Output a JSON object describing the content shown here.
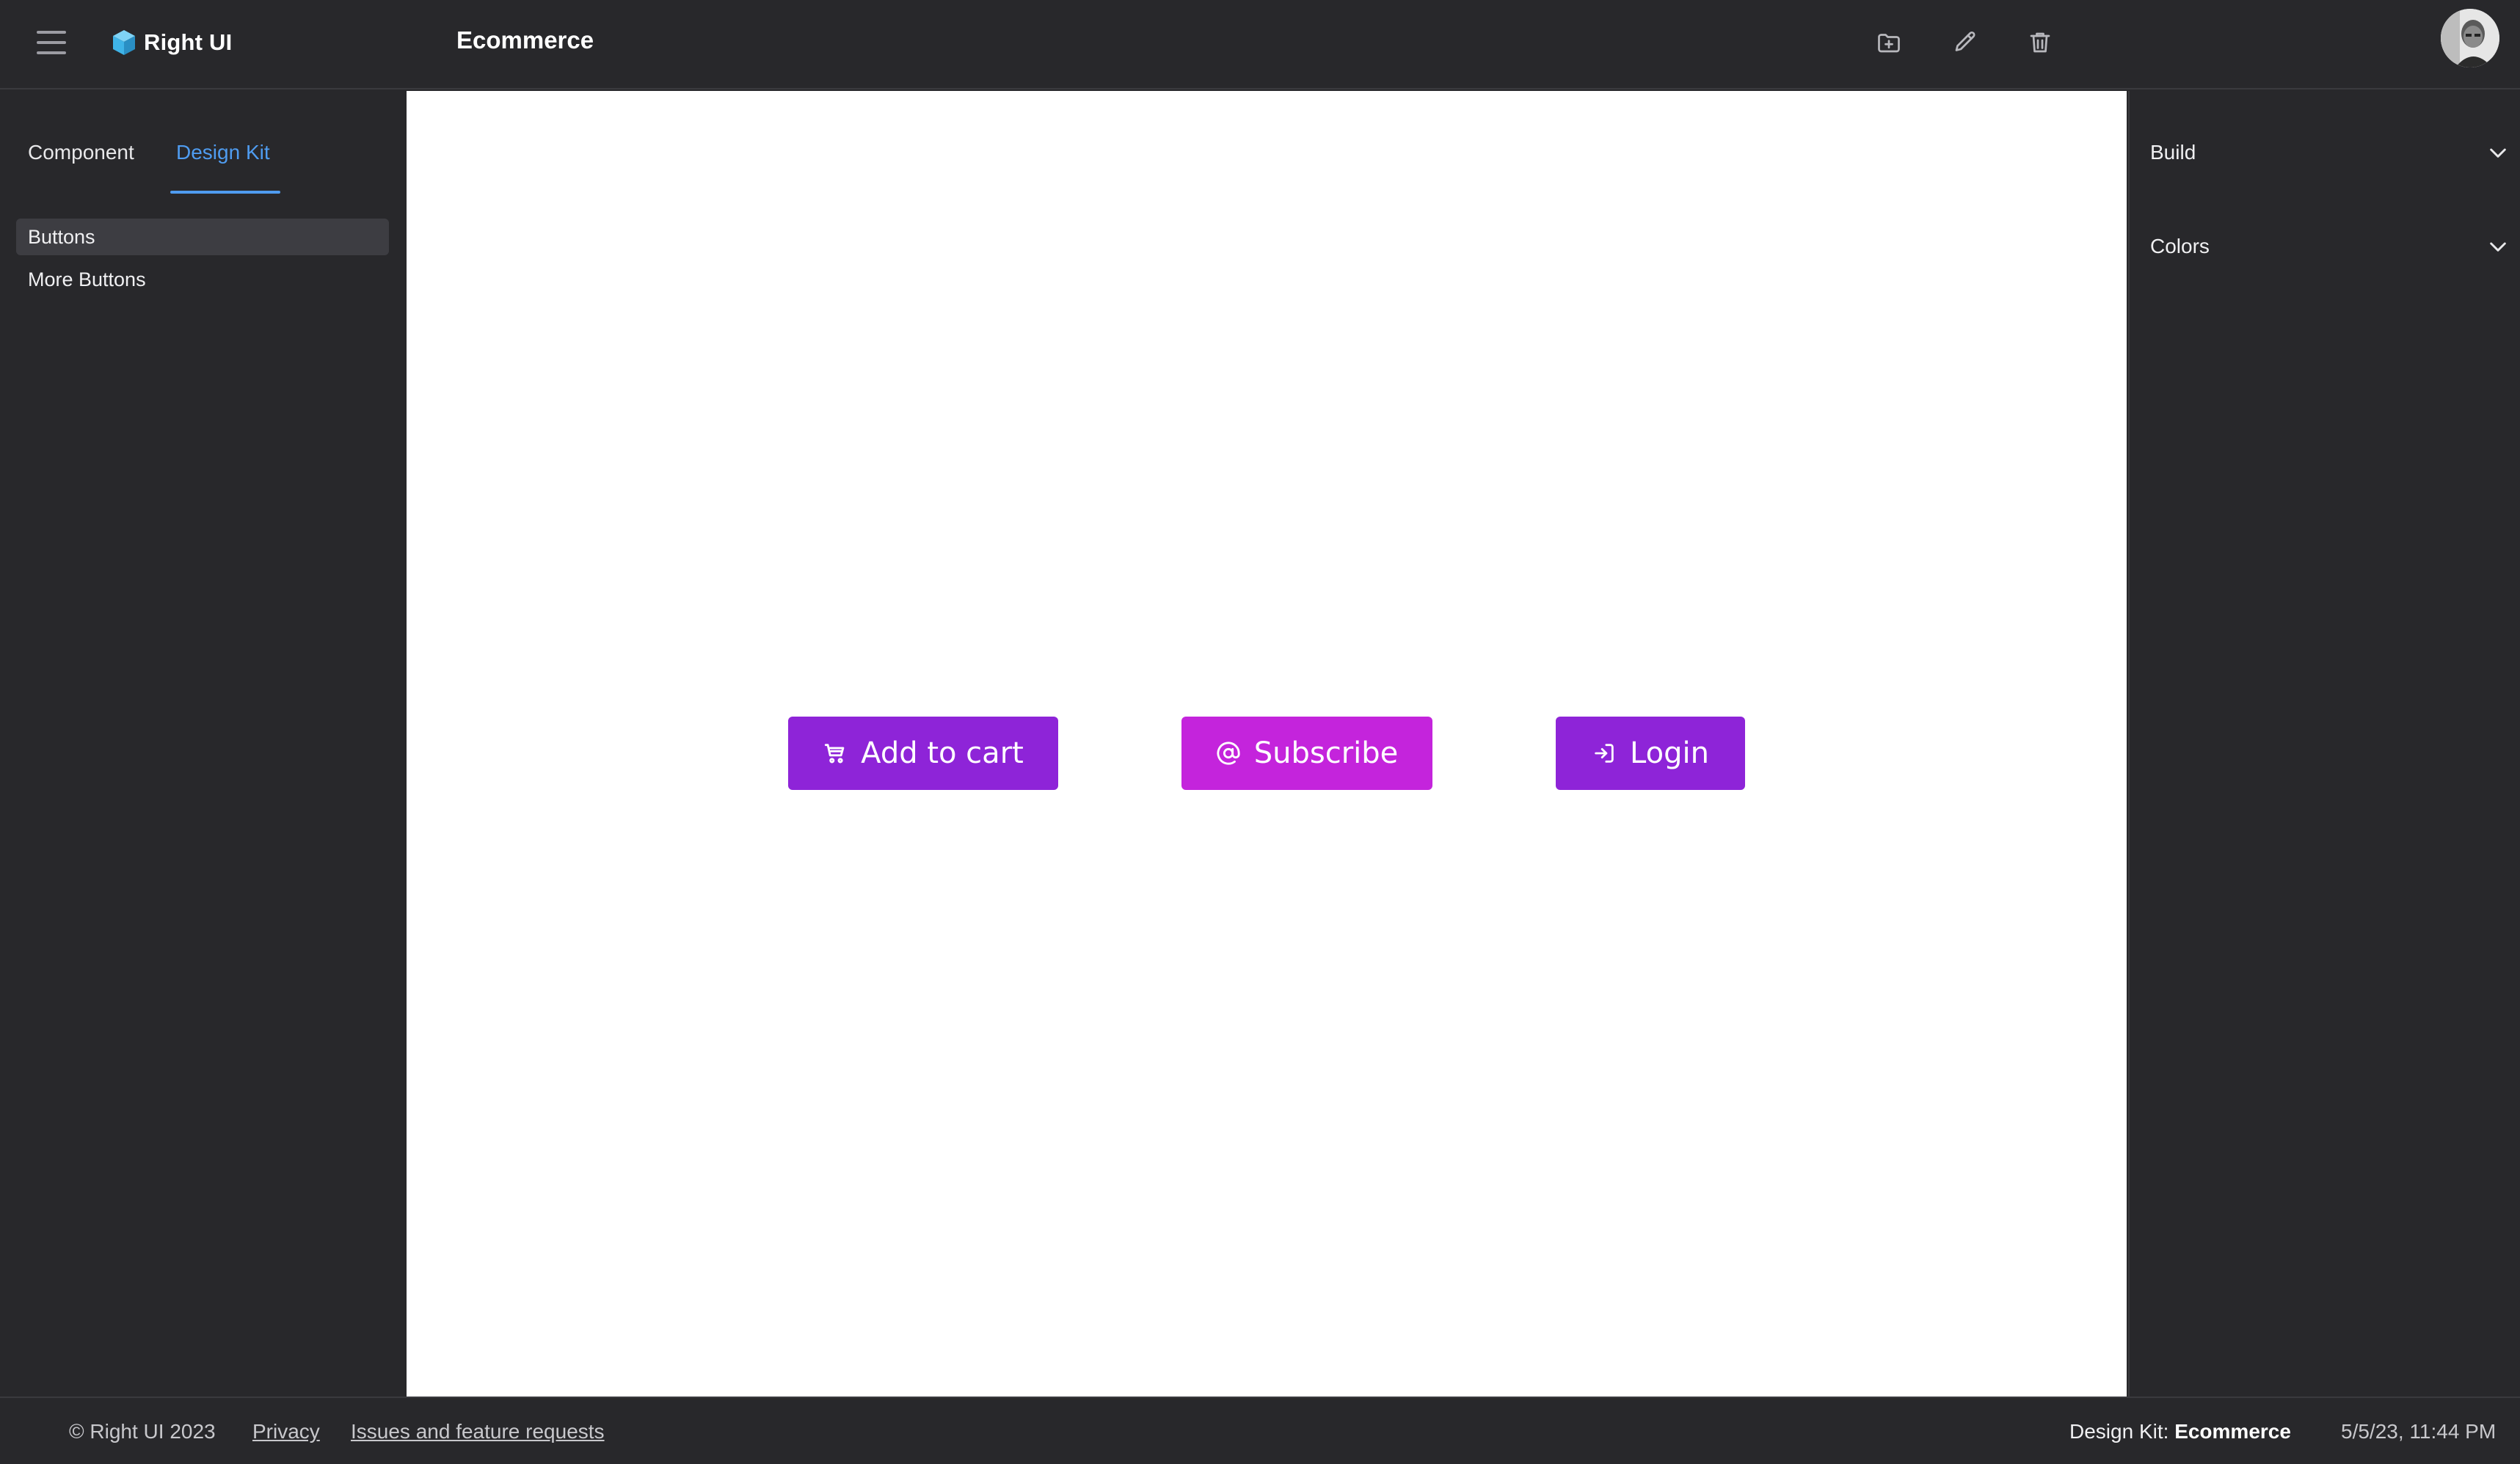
{
  "header": {
    "brand": "Right UI",
    "title": "Ecommerce",
    "icons": [
      "hamburger-menu-icon",
      "cube-logo-icon",
      "folder-plus-icon",
      "pencil-icon",
      "trash-icon"
    ]
  },
  "sidebar": {
    "tabs": [
      {
        "label": "Component",
        "active": false
      },
      {
        "label": "Design Kit",
        "active": true
      }
    ],
    "items": [
      {
        "label": "Buttons",
        "selected": true
      },
      {
        "label": "More Buttons",
        "selected": false
      }
    ]
  },
  "canvas": {
    "buttons": [
      {
        "label": "Add to cart",
        "icon": "cart-icon",
        "color": "#8e24d8"
      },
      {
        "label": "Subscribe",
        "icon": "at-sign-icon",
        "color": "#c424dc"
      },
      {
        "label": "Login",
        "icon": "login-icon",
        "color": "#8e24d8"
      }
    ]
  },
  "panel": {
    "sections": [
      {
        "label": "Build",
        "expanded": false
      },
      {
        "label": "Colors",
        "expanded": false
      }
    ]
  },
  "footer": {
    "copyright": "© Right UI 2023",
    "privacy": "Privacy",
    "issues": "Issues and feature requests",
    "kit_prefix": "Design Kit:",
    "kit_name": "Ecommerce",
    "timestamp": "5/5/23, 11:44 PM"
  },
  "colors": {
    "background": "#28282b",
    "accent": "#4f9cf0",
    "logo": "#3fb4e8"
  }
}
